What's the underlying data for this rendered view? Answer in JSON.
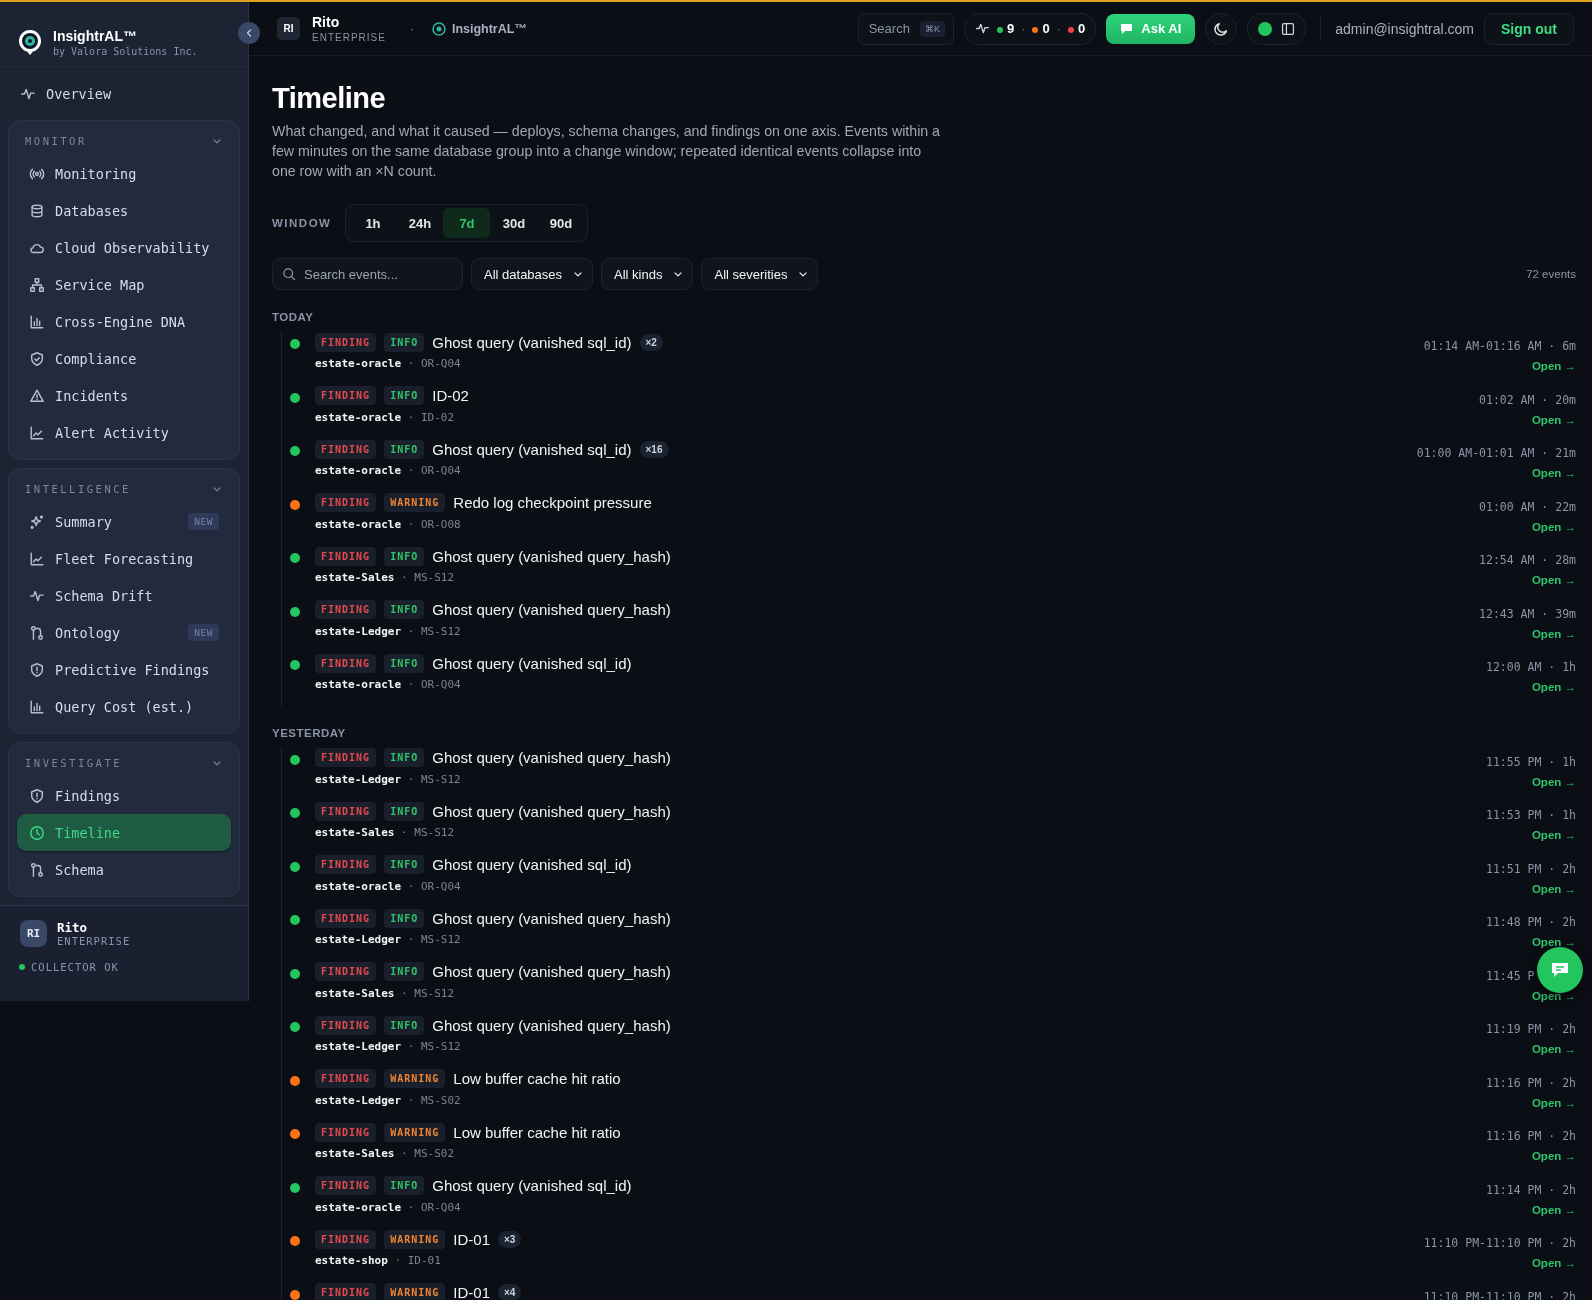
{
  "sidebar": {
    "brand": {
      "name": "InsightrAL™",
      "subtitle": "by Valora Solutions Inc."
    },
    "overview": {
      "label": "Overview",
      "selected": false
    },
    "sections": [
      {
        "title": "MONITOR",
        "expanded": true,
        "items": [
          {
            "label": "Monitoring",
            "selected": false
          },
          {
            "label": "Databases",
            "selected": false
          },
          {
            "label": "Cloud Observability",
            "selected": false
          },
          {
            "label": "Service Map",
            "selected": false
          },
          {
            "label": "Cross-Engine DNA",
            "selected": false
          },
          {
            "label": "Compliance",
            "selected": false
          },
          {
            "label": "Incidents",
            "selected": false
          },
          {
            "label": "Alert Activity",
            "selected": false
          }
        ]
      },
      {
        "title": "INTELLIGENCE",
        "expanded": true,
        "items": [
          {
            "label": "Summary",
            "badge": "NEW",
            "selected": false
          },
          {
            "label": "Fleet Forecasting",
            "selected": false
          },
          {
            "label": "Schema Drift",
            "selected": false
          },
          {
            "label": "Ontology",
            "badge": "NEW",
            "selected": false
          },
          {
            "label": "Predictive Findings",
            "selected": false
          },
          {
            "label": "Query Cost (est.)",
            "selected": false
          }
        ]
      },
      {
        "title": "INVESTIGATE",
        "expanded": true,
        "items": [
          {
            "label": "Findings",
            "selected": false
          },
          {
            "label": "Timeline",
            "selected": true
          },
          {
            "label": "Schema",
            "selected": false
          }
        ]
      }
    ],
    "user": {
      "initials": "RI",
      "name": "Rito",
      "plan": "ENTERPRISE"
    },
    "collector": {
      "label": "COLLECTOR OK",
      "ok": true
    }
  },
  "topbar": {
    "account": {
      "initials": "RI",
      "name": "Rito",
      "plan": "ENTERPRISE"
    },
    "separator": "·",
    "product": "InsightrAL™",
    "search": {
      "label": "Search",
      "shortcut": "⌘K"
    },
    "status": [
      {
        "count": "9",
        "color": "#22c55e"
      },
      {
        "separator": "·",
        "count": "0",
        "color": "#f97316"
      },
      {
        "separator": "·",
        "count": "0",
        "color": "#ef4444"
      }
    ],
    "live": true,
    "ask_ai": "Ask AI",
    "user_email": "admin@insightral.com",
    "sign_out": "Sign out"
  },
  "page": {
    "title": "Timeline",
    "description": "What changed, and what it caused — deploys, schema changes, and findings on one axis. Events within a few minutes on the same database group into a change window; repeated identical events collapse into one row with an ×N count.",
    "window": {
      "label": "WINDOW",
      "options": [
        {
          "label": "1h",
          "selected": false
        },
        {
          "label": "24h",
          "selected": false
        },
        {
          "label": "7d",
          "selected": true
        },
        {
          "label": "30d",
          "selected": false
        },
        {
          "label": "90d",
          "selected": false
        }
      ]
    },
    "search": {
      "placeholder": "Search events..."
    },
    "filters": [
      "All databases",
      "All kinds",
      "All severities"
    ],
    "count": "72 events",
    "groups": [
      {
        "label": "TODAY",
        "events": [
          {
            "kind": "info",
            "tag": "FINDING",
            "severity": "INFO",
            "title": "Ghost query (vanished sql_id)",
            "count": "×2",
            "database": "estate-oracle",
            "separator": "·",
            "code": "OR-Q04",
            "time": "01:14 AM-01:16 AM · 6m",
            "open": "Open →"
          },
          {
            "kind": "info",
            "tag": "FINDING",
            "severity": "INFO",
            "title": "ID-02",
            "database": "estate-oracle",
            "separator": "·",
            "code": "ID-02",
            "time": "01:02 AM · 20m",
            "open": "Open →"
          },
          {
            "kind": "info",
            "tag": "FINDING",
            "severity": "INFO",
            "title": "Ghost query (vanished sql_id)",
            "count": "×16",
            "database": "estate-oracle",
            "separator": "·",
            "code": "OR-Q04",
            "time": "01:00 AM-01:01 AM · 21m",
            "open": "Open →"
          },
          {
            "kind": "warning",
            "tag": "FINDING",
            "severity": "WARNING",
            "title": "Redo log checkpoint pressure",
            "database": "estate-oracle",
            "separator": "·",
            "code": "OR-O08",
            "time": "01:00 AM · 22m",
            "open": "Open →"
          },
          {
            "kind": "info",
            "tag": "FINDING",
            "severity": "INFO",
            "title": "Ghost query (vanished query_hash)",
            "database": "estate-Sales",
            "separator": "·",
            "code": "MS-S12",
            "time": "12:54 AM · 28m",
            "open": "Open →"
          },
          {
            "kind": "info",
            "tag": "FINDING",
            "severity": "INFO",
            "title": "Ghost query (vanished query_hash)",
            "database": "estate-Ledger",
            "separator": "·",
            "code": "MS-S12",
            "time": "12:43 AM · 39m",
            "open": "Open →"
          },
          {
            "kind": "info",
            "tag": "FINDING",
            "severity": "INFO",
            "title": "Ghost query (vanished sql_id)",
            "database": "estate-oracle",
            "separator": "·",
            "code": "OR-Q04",
            "time": "12:00 AM · 1h",
            "open": "Open →"
          }
        ]
      },
      {
        "label": "YESTERDAY",
        "events": [
          {
            "kind": "info",
            "tag": "FINDING",
            "severity": "INFO",
            "title": "Ghost query (vanished query_hash)",
            "database": "estate-Ledger",
            "separator": "·",
            "code": "MS-S12",
            "time": "11:55 PM · 1h",
            "open": "Open →"
          },
          {
            "kind": "info",
            "tag": "FINDING",
            "severity": "INFO",
            "title": "Ghost query (vanished query_hash)",
            "database": "estate-Sales",
            "separator": "·",
            "code": "MS-S12",
            "time": "11:53 PM · 1h",
            "open": "Open →"
          },
          {
            "kind": "info",
            "tag": "FINDING",
            "severity": "INFO",
            "title": "Ghost query (vanished sql_id)",
            "database": "estate-oracle",
            "separator": "·",
            "code": "OR-Q04",
            "time": "11:51 PM · 2h",
            "open": "Open →"
          },
          {
            "kind": "info",
            "tag": "FINDING",
            "severity": "INFO",
            "title": "Ghost query (vanished query_hash)",
            "database": "estate-Ledger",
            "separator": "·",
            "code": "MS-S12",
            "time": "11:48 PM · 2h",
            "open": "Open →"
          },
          {
            "kind": "info",
            "tag": "FINDING",
            "severity": "INFO",
            "title": "Ghost query (vanished query_hash)",
            "database": "estate-Sales",
            "separator": "·",
            "code": "MS-S12",
            "time": "11:45 P",
            "open": "Open →"
          },
          {
            "kind": "info",
            "tag": "FINDING",
            "severity": "INFO",
            "title": "Ghost query (vanished query_hash)",
            "database": "estate-Ledger",
            "separator": "·",
            "code": "MS-S12",
            "time": "11:19 PM · 2h",
            "open": "Open →"
          },
          {
            "kind": "warning",
            "tag": "FINDING",
            "severity": "WARNING",
            "title": "Low buffer cache hit ratio",
            "database": "estate-Ledger",
            "separator": "·",
            "code": "MS-S02",
            "time": "11:16 PM · 2h",
            "open": "Open →"
          },
          {
            "kind": "warning",
            "tag": "FINDING",
            "severity": "WARNING",
            "title": "Low buffer cache hit ratio",
            "database": "estate-Sales",
            "separator": "·",
            "code": "MS-S02",
            "time": "11:16 PM · 2h",
            "open": "Open →"
          },
          {
            "kind": "info",
            "tag": "FINDING",
            "severity": "INFO",
            "title": "Ghost query (vanished sql_id)",
            "database": "estate-oracle",
            "separator": "·",
            "code": "OR-Q04",
            "time": "11:14 PM · 2h",
            "open": "Open →"
          },
          {
            "kind": "warning",
            "tag": "FINDING",
            "severity": "WARNING",
            "title": "ID-01",
            "count": "×3",
            "database": "estate-shop",
            "separator": "·",
            "code": "ID-01",
            "time": "11:10 PM-11:10 PM · 2h",
            "open": "Open →"
          },
          {
            "kind": "warning",
            "tag": "FINDING",
            "severity": "WARNING",
            "title": "ID-01",
            "count": "×4",
            "time": "11:10 PM-11:10 PM · 2h"
          }
        ]
      }
    ]
  }
}
